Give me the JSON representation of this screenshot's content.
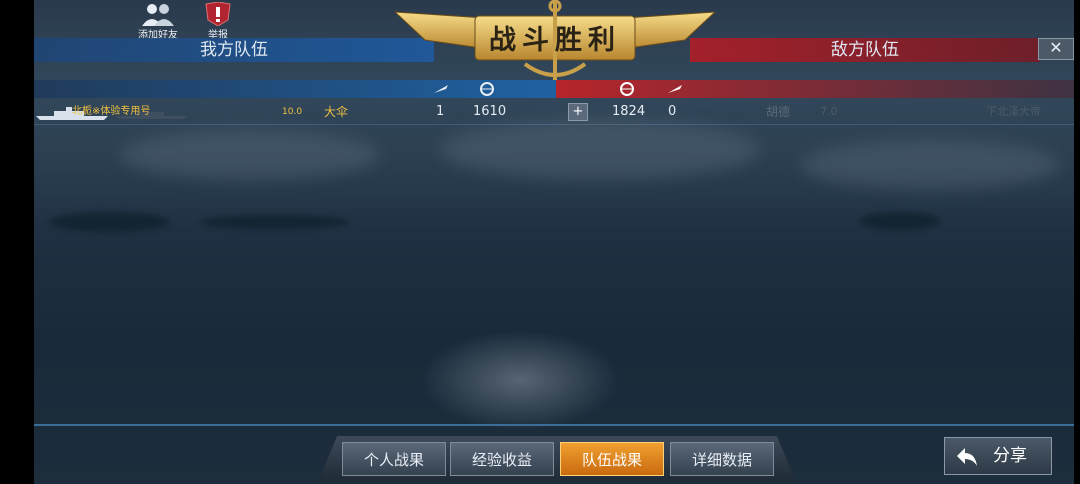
{
  "top_buttons": {
    "add_friend": "添加好友",
    "report": "举报"
  },
  "title": "战斗胜利",
  "teams": {
    "ours": "我方队伍",
    "enemy": "敌方队伍"
  },
  "close_label": "✕",
  "row": {
    "player": "北栀※体验专用号",
    "level": "10.0",
    "ship": "大伞",
    "kills": "1",
    "score": "1610",
    "plus": "+",
    "enemy_score": "1824",
    "enemy_kills": "0",
    "enemy_ship": "胡德",
    "enemy_level": "7.0",
    "enemy_player": "下北泽大帝"
  },
  "tabs": [
    "个人战果",
    "经验收益",
    "队伍战果",
    "详细数据"
  ],
  "active_tab": "队伍战果",
  "share_label": "分享",
  "colors": {
    "our_team": "#1e5a9c",
    "enemy_team": "#a81e28",
    "gold": "#f0c040",
    "active_tab": "#e88a20"
  }
}
